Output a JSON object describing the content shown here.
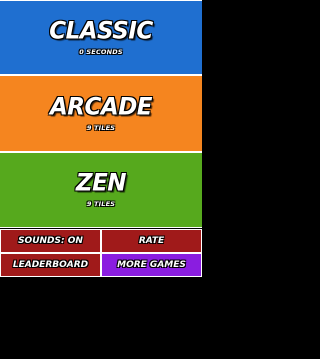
{
  "modes": {
    "classic": {
      "title": "CLASSIC",
      "subtitle": "0 SECONDS"
    },
    "arcade": {
      "title": "ARCADE",
      "subtitle": "9 TILES"
    },
    "zen": {
      "title": "ZEN",
      "subtitle": "9 TILES"
    }
  },
  "buttons": {
    "sounds": "SOUNDS: ON",
    "rate": "RATE",
    "leaderboard": "LEADERBOARD",
    "more_games": "MORE GAMES"
  },
  "colors": {
    "classic": "#1f6fd0",
    "arcade": "#f5851f",
    "zen": "#56a91d",
    "menu_red": "#a01a1a",
    "more_games_purple": "#8a1de0",
    "background": "#000000"
  }
}
